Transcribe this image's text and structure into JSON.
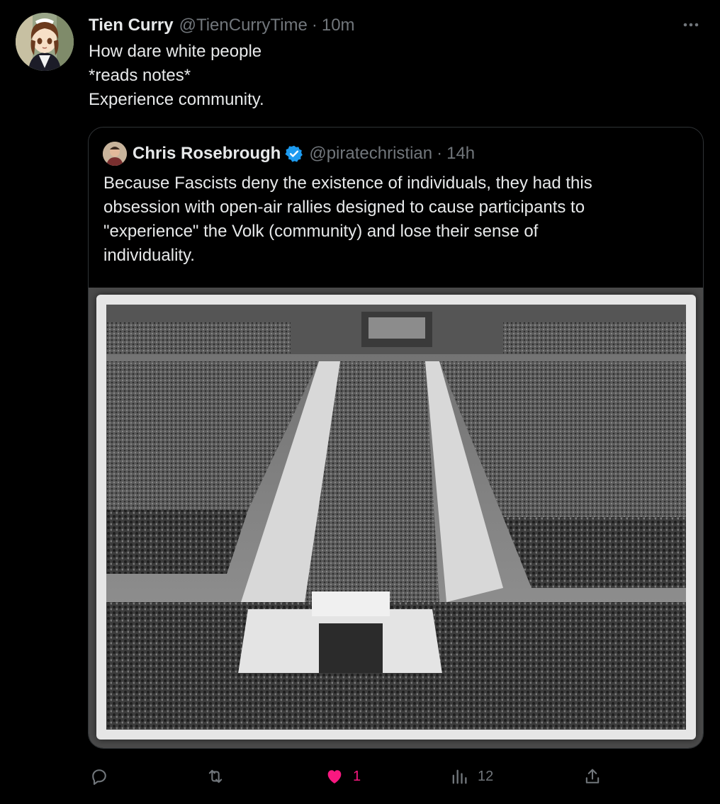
{
  "tweet": {
    "author_name": "Tien Curry",
    "author_handle": "@TienCurryTime",
    "separator": "·",
    "time": "10m",
    "lines": [
      "How dare white people",
      "*reads notes*",
      "Experience community."
    ]
  },
  "quoted_tweet": {
    "author_name": "Chris Rosebrough",
    "verified": true,
    "author_handle": "@piratechristian",
    "separator": "·",
    "time": "14h",
    "lines": [
      "Because Fascists deny the existence of individuals, they had this",
      "obsession with open-air rallies designed to cause participants to",
      "\"experience\" the Volk (community) and lose their sense of",
      "individuality."
    ],
    "media": "black-and-white photo of a large open-air rally with massed ranks of people"
  },
  "actions": {
    "reply": {
      "icon": "reply-icon",
      "count": ""
    },
    "retweet": {
      "icon": "retweet-icon",
      "count": ""
    },
    "like": {
      "icon": "heart-icon",
      "count": "1",
      "liked": true
    },
    "views": {
      "icon": "views-icon",
      "count": "12"
    },
    "share": {
      "icon": "share-icon"
    }
  },
  "colors": {
    "background": "#000000",
    "text": "#e7e9ea",
    "secondary": "#71767b",
    "like": "#f91880",
    "verified": "#1d9bf0"
  }
}
